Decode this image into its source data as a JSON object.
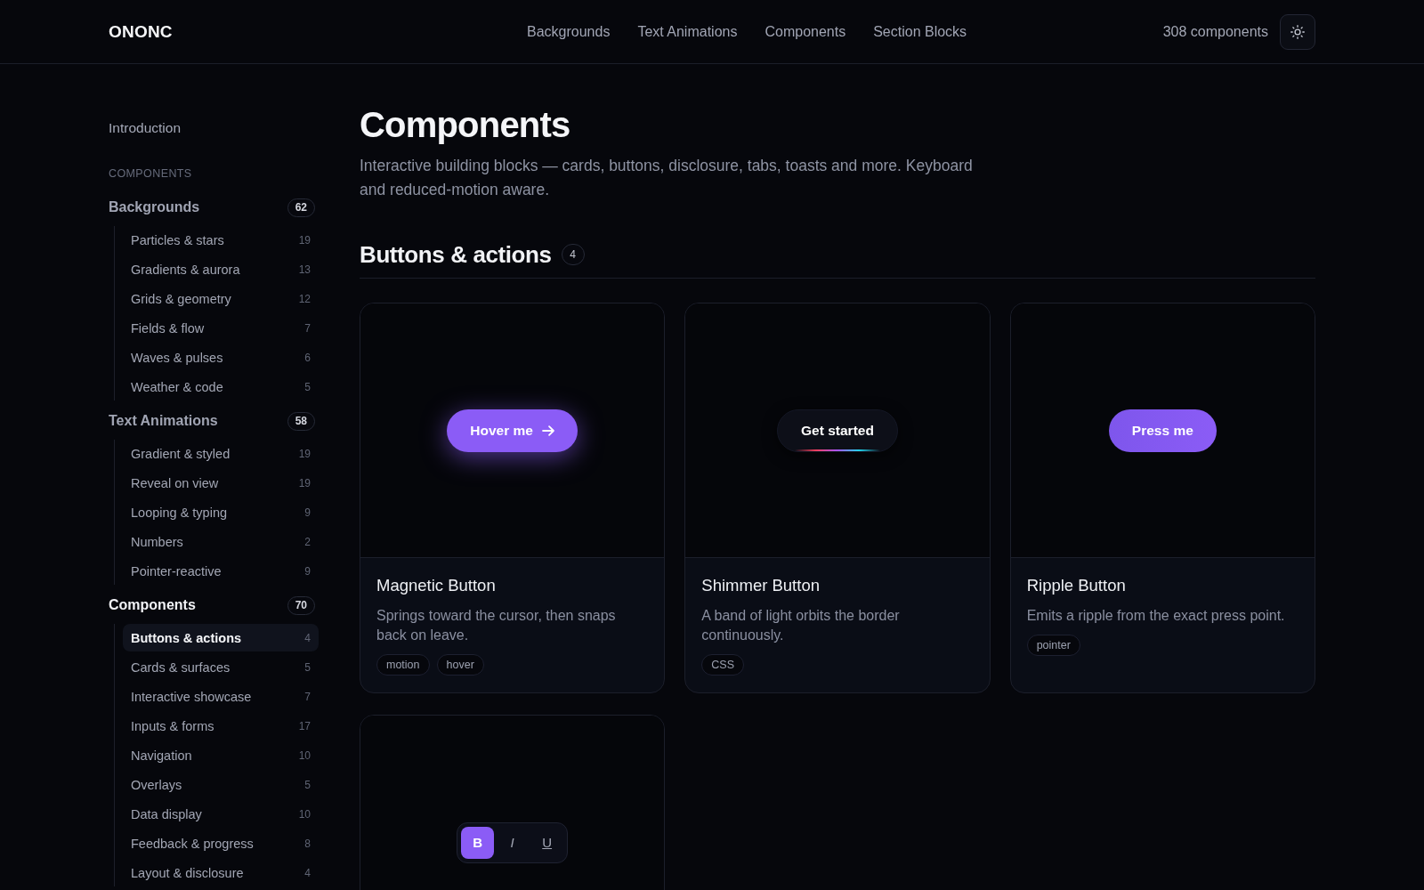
{
  "header": {
    "logo": "ONONC",
    "nav": [
      "Backgrounds",
      "Text Animations",
      "Components",
      "Section Blocks"
    ],
    "count": "308 components"
  },
  "sidebar": {
    "intro": "Introduction",
    "section_label": "COMPONENTS",
    "groups": [
      {
        "label": "Backgrounds",
        "count": "62",
        "selected": false,
        "items": [
          {
            "label": "Particles & stars",
            "count": "19",
            "selected": false
          },
          {
            "label": "Gradients & aurora",
            "count": "13",
            "selected": false
          },
          {
            "label": "Grids & geometry",
            "count": "12",
            "selected": false
          },
          {
            "label": "Fields & flow",
            "count": "7",
            "selected": false
          },
          {
            "label": "Waves & pulses",
            "count": "6",
            "selected": false
          },
          {
            "label": "Weather & code",
            "count": "5",
            "selected": false
          }
        ]
      },
      {
        "label": "Text Animations",
        "count": "58",
        "selected": false,
        "items": [
          {
            "label": "Gradient & styled",
            "count": "19",
            "selected": false
          },
          {
            "label": "Reveal on view",
            "count": "19",
            "selected": false
          },
          {
            "label": "Looping & typing",
            "count": "9",
            "selected": false
          },
          {
            "label": "Numbers",
            "count": "2",
            "selected": false
          },
          {
            "label": "Pointer-reactive",
            "count": "9",
            "selected": false
          }
        ]
      },
      {
        "label": "Components",
        "count": "70",
        "selected": true,
        "items": [
          {
            "label": "Buttons & actions",
            "count": "4",
            "selected": true
          },
          {
            "label": "Cards & surfaces",
            "count": "5",
            "selected": false
          },
          {
            "label": "Interactive showcase",
            "count": "7",
            "selected": false
          },
          {
            "label": "Inputs & forms",
            "count": "17",
            "selected": false
          },
          {
            "label": "Navigation",
            "count": "10",
            "selected": false
          },
          {
            "label": "Overlays",
            "count": "5",
            "selected": false
          },
          {
            "label": "Data display",
            "count": "10",
            "selected": false
          },
          {
            "label": "Feedback & progress",
            "count": "8",
            "selected": false
          },
          {
            "label": "Layout & disclosure",
            "count": "4",
            "selected": false
          }
        ]
      }
    ]
  },
  "page": {
    "title": "Components",
    "description": "Interactive building blocks — cards, buttons, disclosure, tabs, toasts and more. Keyboard and reduced-motion aware."
  },
  "section": {
    "title": "Buttons & actions",
    "count": "4"
  },
  "cards": [
    {
      "kind": "magnetic",
      "preview": {
        "label": "Hover me"
      },
      "title": "Magnetic Button",
      "description": "Springs toward the cursor, then snaps back on leave.",
      "tags": [
        "motion",
        "hover"
      ]
    },
    {
      "kind": "shimmer",
      "preview": {
        "label": "Get started"
      },
      "title": "Shimmer Button",
      "description": "A band of light orbits the border continuously.",
      "tags": [
        "CSS"
      ]
    },
    {
      "kind": "ripple",
      "preview": {
        "label": "Press me"
      },
      "title": "Ripple Button",
      "description": "Emits a ripple from the exact press point.",
      "tags": [
        "pointer"
      ]
    },
    {
      "kind": "toolbar",
      "preview": {
        "buttons": [
          {
            "kind": "bold",
            "label": "B",
            "selected": true
          },
          {
            "kind": "italic",
            "label": "I",
            "selected": false
          },
          {
            "kind": "underline",
            "label": "U",
            "selected": false
          }
        ]
      }
    }
  ]
}
